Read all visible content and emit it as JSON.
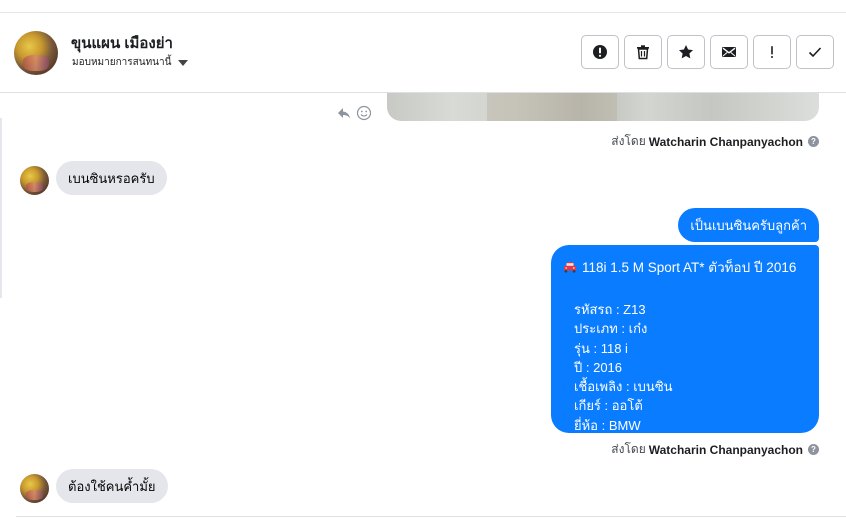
{
  "header": {
    "contact_name": "ขุนแผน เมืองย่า",
    "assign_label": "มอบหมายการสนทนานี้",
    "actions": [
      {
        "name": "report-spam-button",
        "icon": "alert-circle-icon"
      },
      {
        "name": "delete-button",
        "icon": "trash-icon"
      },
      {
        "name": "star-button",
        "icon": "star-icon"
      },
      {
        "name": "mark-unread-button",
        "icon": "envelope-icon"
      },
      {
        "name": "follow-up-button",
        "icon": "exclamation-icon"
      },
      {
        "name": "mark-done-button",
        "icon": "check-icon"
      }
    ]
  },
  "thread": {
    "sent_by_prefix": "ส่งโดย",
    "sender_name": "Watcharin Chanpanyachon",
    "info_glyph": "?",
    "messages": {
      "in_1": "เบนซินหรอครับ",
      "out_1": "เป็นเบนซินครับลูกค้า",
      "out_2_title": "118i 1.5 M Sport AT* ตัวท็อป ปี 2016",
      "out_2_specs": [
        "รหัสรถ : Z13",
        "ประเภท : เก๋ง",
        "รุ่น : 118 i",
        "ปี : 2016",
        "เชื้อเพลิง : เบนซิน",
        "เกียร์ : ออโต้",
        "ยี่ห้อ : BMW"
      ],
      "in_2": "ต้องใช้คนค้ำมั้ย"
    }
  },
  "colors": {
    "accent": "#0a7cff",
    "incoming_bubble": "#e4e6eb",
    "car_icon": "#e0384f"
  }
}
